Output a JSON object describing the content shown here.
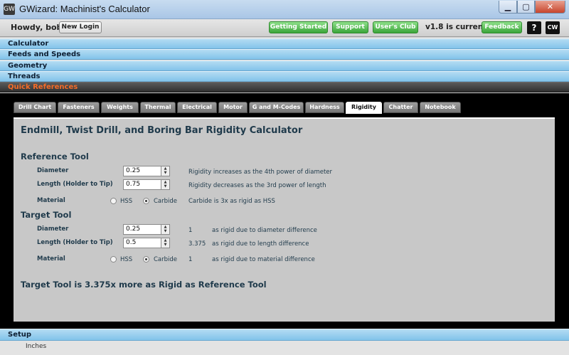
{
  "window": {
    "title": "GWizard: Machinist's Calculator",
    "app_icon": "GW"
  },
  "toolbar": {
    "greeting": "Howdy, bob!",
    "new_login": "New Login",
    "getting_started": "Getting Started",
    "support": "Support",
    "users_club": "User's Club",
    "version": "v1.8 is current",
    "feedback": "Feedback",
    "help_glyph": "?",
    "logo_glyph": "CW"
  },
  "sections": [
    "Calculator",
    "Feeds and Speeds",
    "Geometry",
    "Threads",
    "Quick References"
  ],
  "tabs": [
    "Drill Chart",
    "Fasteners",
    "Weights",
    "Thermal",
    "Electrical",
    "Motor",
    "G and M-Codes",
    "Hardness",
    "Rigidity",
    "Chatter",
    "Notebook"
  ],
  "calc": {
    "title": "Endmill, Twist Drill, and Boring Bar Rigidity Calculator",
    "reference": {
      "heading": "Reference Tool",
      "diameter_label": "Diameter",
      "diameter_value": "0.25",
      "diameter_note": "Rigidity increases as the 4th power of diameter",
      "length_label": "Length (Holder to Tip)",
      "length_value": "0.75",
      "length_note": "Rigidity decreases as the 3rd power of length",
      "material_label": "Material",
      "hss": "HSS",
      "carbide": "Carbide",
      "material_note": "Carbide is 3x as rigid as HSS"
    },
    "target": {
      "heading": "Target Tool",
      "diameter_label": "Diameter",
      "diameter_value": "0.25",
      "diameter_factor": "1",
      "diameter_note": "as rigid due to diameter difference",
      "length_label": "Length (Holder to Tip)",
      "length_value": "0.5",
      "length_factor": "3.375",
      "length_note": "as rigid due to length difference",
      "material_label": "Material",
      "hss": "HSS",
      "carbide": "Carbide",
      "material_factor": "1",
      "material_note": "as rigid due to material difference"
    },
    "result": "Target Tool is 3.375x more as Rigid as Reference Tool"
  },
  "setup": {
    "label": "Setup",
    "status": "Inches"
  }
}
